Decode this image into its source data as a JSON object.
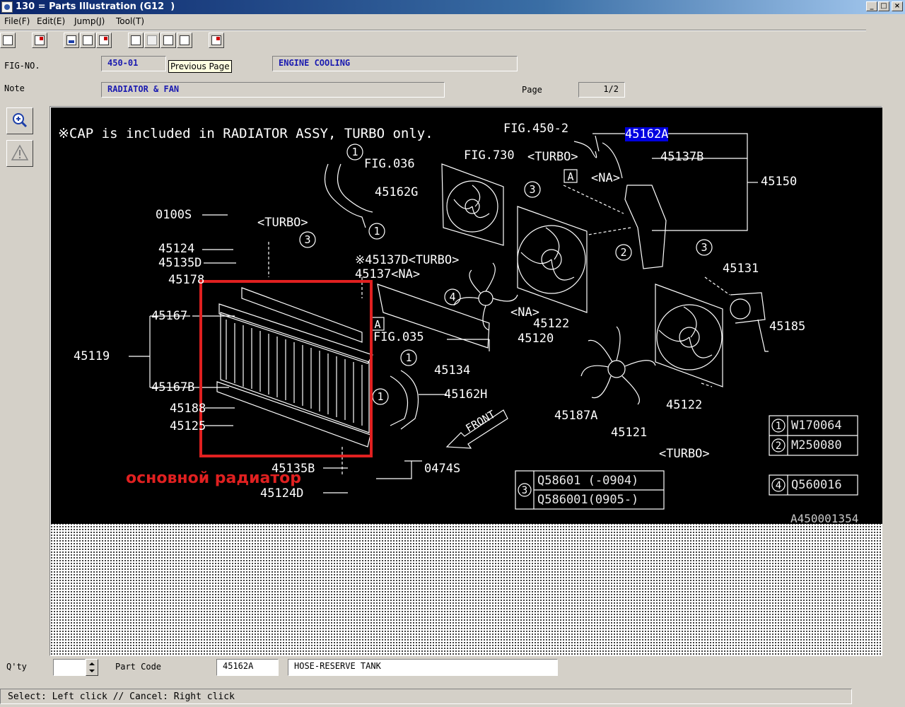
{
  "window": {
    "title": "130 = Parts Illustration (G12  )",
    "buttons": {
      "minimize": "_",
      "maximize": "□",
      "close": "×"
    }
  },
  "menu": [
    "File(F)",
    "Edit(E)",
    "Jump(J)",
    "Tool(T)"
  ],
  "tooltip": "Previous Page",
  "header": {
    "fig_no_label": "FIG-NO.",
    "fig_no": "450-01",
    "section": "ENGINE COOLING",
    "note_label": "Note",
    "note": "RADIATOR & FAN",
    "page_label": "Page",
    "page": "1/2"
  },
  "drawing": {
    "notice": "※CAP is included in RADIATOR ASSY, TURBO only.",
    "highlight_part": "45162A",
    "illustration_id": "A450001354",
    "annotation": "основной радиатор",
    "labels": [
      "FIG.450-2",
      "FIG.730",
      "<TURBO>",
      "<NA>",
      "45137B",
      "45150",
      "FIG.036",
      "45162G",
      "0100S",
      "<TURBO>",
      "45124",
      "45135D",
      "45178",
      "※45137D<TURBO>",
      "45137<NA>",
      "45167",
      "45119",
      "45167B",
      "45188",
      "45125",
      "FIG.035",
      "45134",
      "45162H",
      "45120",
      "<NA>",
      "45122",
      "45131",
      "45185",
      "45187A",
      "45121",
      "45122",
      "<TURBO>",
      "45135B",
      "45124D",
      "0474S",
      "FRONT"
    ],
    "callout_numbers": [
      "1",
      "1",
      "1",
      "1",
      "2",
      "3",
      "3",
      "3",
      "4"
    ],
    "box_letters": [
      "A",
      "A"
    ],
    "legend": [
      {
        "n": "1",
        "code": "W170064"
      },
      {
        "n": "2",
        "code": "M250080"
      },
      {
        "n": "3",
        "code": "Q58601 (-0904)"
      },
      {
        "n": "3",
        "code": "Q586001(0905-)"
      },
      {
        "n": "4",
        "code": "Q560016"
      }
    ]
  },
  "footer": {
    "qty_label": "Q'ty",
    "qty_value": "",
    "part_code_label": "Part Code",
    "part_code": "45162A",
    "part_name": "HOSE-RESERVE TANK"
  },
  "status": "Select: Left click // Cancel: Right click",
  "colors": {
    "highlight": "#0000e0",
    "annotation": "#e02020",
    "field_text": "#1a1ab0"
  }
}
